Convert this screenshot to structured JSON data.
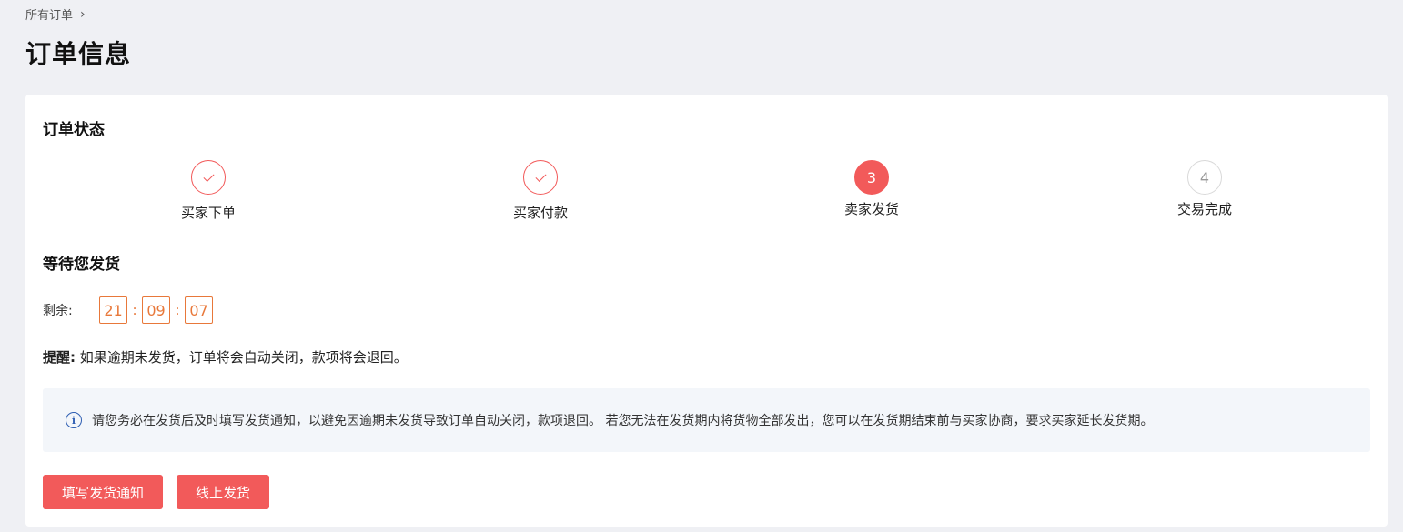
{
  "breadcrumb": {
    "item": "所有订单"
  },
  "page": {
    "title": "订单信息"
  },
  "status": {
    "section_title": "订单状态",
    "steps": [
      {
        "label": "买家下单",
        "state": "done",
        "number": "1"
      },
      {
        "label": "买家付款",
        "state": "done",
        "number": "2"
      },
      {
        "label": "卖家发货",
        "state": "active",
        "number": "3"
      },
      {
        "label": "交易完成",
        "state": "todo",
        "number": "4"
      }
    ]
  },
  "waiting": {
    "title": "等待您发货",
    "remaining_label": "剩余:",
    "hours": "21",
    "minutes": "09",
    "seconds": "07",
    "separator": ":"
  },
  "reminder": {
    "label": "提醒:",
    "text": "如果逾期未发货，订单将会自动关闭，款项将会退回。"
  },
  "notice": {
    "text": "请您务必在发货后及时填写发货通知，以避免因逾期未发货导致订单自动关闭，款项退回。 若您无法在发货期内将货物全部发出，您可以在发货期结束前与买家协商，要求买家延长发货期。"
  },
  "actions": {
    "fill_notice": "填写发货通知",
    "online_ship": "线上发货"
  },
  "colors": {
    "accent": "#f25a5a",
    "countdown": "#e8783a",
    "info": "#2f5fb3"
  }
}
